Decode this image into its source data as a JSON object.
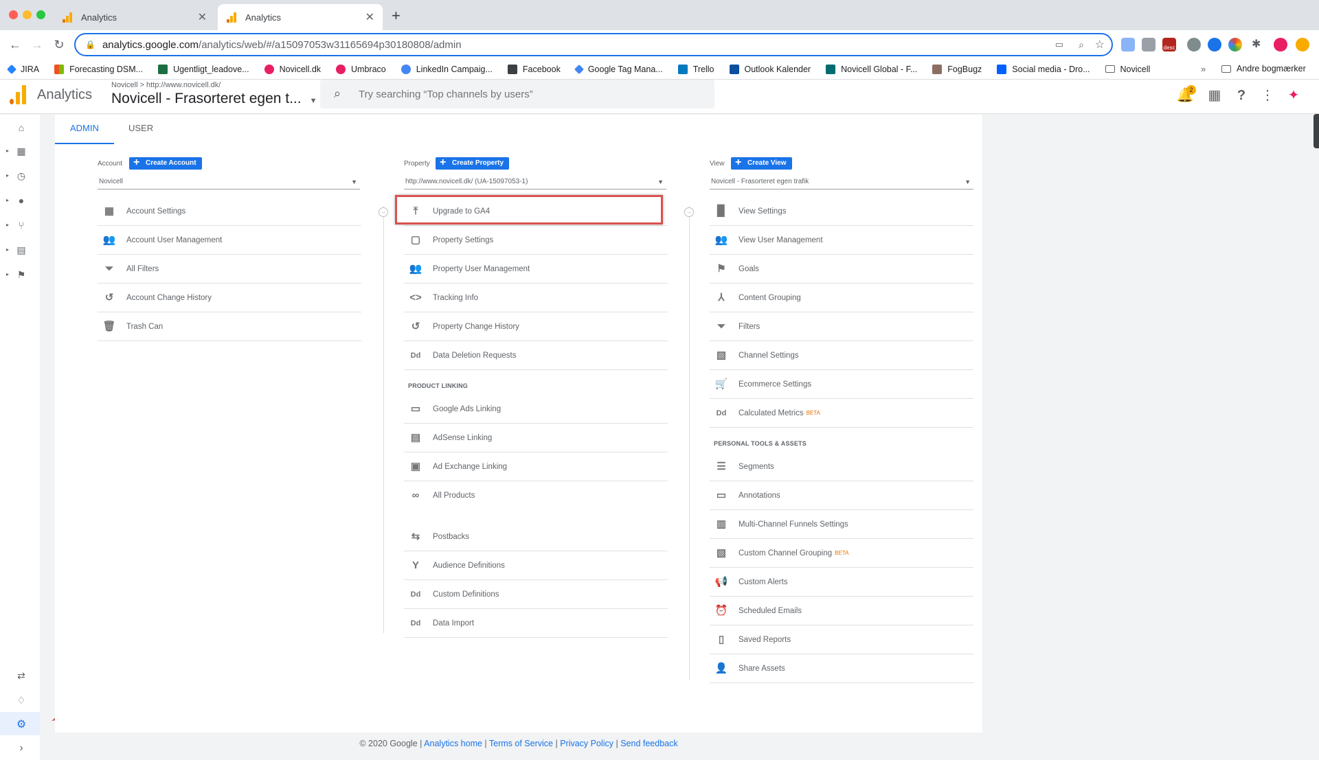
{
  "browser": {
    "tabs": [
      {
        "title": "Analytics"
      },
      {
        "title": "Analytics"
      }
    ],
    "url_host": "analytics.google.com",
    "url_path": "/analytics/web/#/a15097053w31165694p30180808/admin",
    "new_tab_symbol": "+",
    "ext_badge": "desc",
    "bookmarks": [
      "JIRA",
      "Forecasting DSM...",
      "Ugentligt_leadove...",
      "Novicell.dk",
      "Umbraco",
      "LinkedIn Campaig...",
      "Facebook",
      "Google Tag Mana...",
      "Trello",
      "Outlook Kalender",
      "Novicell Global - F...",
      "FogBugz",
      "Social media - Dro...",
      "Novicell"
    ],
    "bookmarks_overflow": "»",
    "other_bookmarks": "Andre bogmærker"
  },
  "header": {
    "app_title": "Analytics",
    "breadcrumb": "Novicell  >  http://www.novicell.dk/",
    "property_name": "Novicell - Frasorteret egen t...",
    "search_placeholder": "Try searching “Top channels by users”",
    "notif_count": "2"
  },
  "tabs": {
    "admin": "ADMIN",
    "user": "USER"
  },
  "account": {
    "label": "Account",
    "create": "Create Account",
    "selected": "Novicell",
    "items": [
      "Account Settings",
      "Account User Management",
      "All Filters",
      "Account Change History",
      "Trash Can"
    ]
  },
  "property": {
    "label": "Property",
    "create": "Create Property",
    "selected": "http://www.novicell.dk/ (UA-15097053-1)",
    "items": [
      "Upgrade to GA4",
      "Property Settings",
      "Property User Management",
      "Tracking Info",
      "Property Change History",
      "Data Deletion Requests"
    ],
    "section": "PRODUCT LINKING",
    "linking": [
      "Google Ads Linking",
      "AdSense Linking",
      "Ad Exchange Linking",
      "All Products"
    ],
    "more": [
      "Postbacks",
      "Audience Definitions",
      "Custom Definitions",
      "Data Import"
    ]
  },
  "view": {
    "label": "View",
    "create": "Create View",
    "selected": "Novicell - Frasorteret egen trafik",
    "items": [
      "View Settings",
      "View User Management",
      "Goals",
      "Content Grouping",
      "Filters",
      "Channel Settings",
      "Ecommerce Settings",
      "Calculated Metrics"
    ],
    "beta": "BETA",
    "section": "PERSONAL TOOLS & ASSETS",
    "tools": [
      "Segments",
      "Annotations",
      "Multi-Channel Funnels Settings",
      "Custom Channel Grouping",
      "Custom Alerts",
      "Scheduled Emails",
      "Saved Reports",
      "Share Assets"
    ]
  },
  "footer": {
    "copyright": "© 2020 Google",
    "links": [
      "Analytics home",
      "Terms of Service",
      "Privacy Policy",
      "Send feedback"
    ]
  },
  "colors": {
    "accent": "#1a73e8",
    "highlight": "#d9534f",
    "ga_orange": "#f9ab00",
    "ga_dark_orange": "#e37400"
  }
}
